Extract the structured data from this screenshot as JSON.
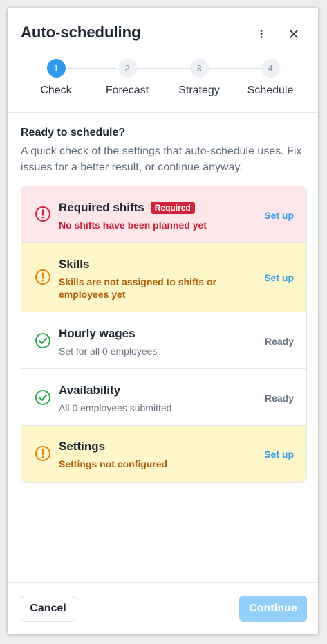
{
  "header": {
    "title": "Auto-scheduling",
    "more_icon": "more-vertical-icon",
    "close_icon": "close-icon"
  },
  "steps": [
    {
      "number": "1",
      "label": "Check",
      "active": true
    },
    {
      "number": "2",
      "label": "Forecast",
      "active": false
    },
    {
      "number": "3",
      "label": "Strategy",
      "active": false
    },
    {
      "number": "4",
      "label": "Schedule",
      "active": false
    }
  ],
  "intro": {
    "title": "Ready to schedule?",
    "description": "A quick check of the settings that auto-schedule uses. Fix issues for a better result, or continue anyway."
  },
  "checklist": [
    {
      "title": "Required shifts",
      "badge": "Required",
      "subtitle": "No shifts have been planned yet",
      "action": "Set up",
      "status": "error"
    },
    {
      "title": "Skills",
      "badge": "",
      "subtitle": "Skills are not assigned to shifts or employees yet",
      "action": "Set up",
      "status": "warning"
    },
    {
      "title": "Hourly wages",
      "badge": "",
      "subtitle": "Set for all 0 employees",
      "action": "Ready",
      "status": "ready"
    },
    {
      "title": "Availability",
      "badge": "",
      "subtitle": "All 0 employees submitted",
      "action": "Ready",
      "status": "ready"
    },
    {
      "title": "Settings",
      "badge": "",
      "subtitle": "Settings not configured",
      "action": "Set up",
      "status": "warning"
    }
  ],
  "footer": {
    "cancel_label": "Cancel",
    "continue_label": "Continue"
  },
  "colors": {
    "accent": "#2f9bea",
    "error": "#d0243a",
    "warning": "#e5830e",
    "success": "#2fa84f"
  }
}
